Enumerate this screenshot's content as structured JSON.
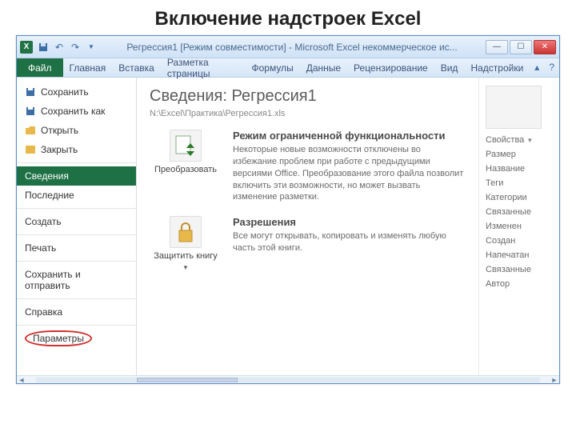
{
  "slide_title": "Включение надстроек Excel",
  "titlebar": {
    "app_letter": "X",
    "document": "Регрессия1 [Режим совместимости] - Microsoft Excel некоммерческое ис..."
  },
  "ribbon": {
    "file": "Файл",
    "tabs": [
      "Главная",
      "Вставка",
      "Разметка страницы",
      "Формулы",
      "Данные",
      "Рецензирование",
      "Вид",
      "Надстройки"
    ]
  },
  "backstage_left": {
    "save": "Сохранить",
    "save_as": "Сохранить как",
    "open": "Открыть",
    "close": "Закрыть",
    "info": "Сведения",
    "recent": "Последние",
    "new": "Создать",
    "print": "Печать",
    "share": "Сохранить и отправить",
    "help": "Справка",
    "options": "Параметры"
  },
  "center": {
    "title": "Сведения: Регрессия1",
    "path": "N:\\Excel\\Практика\\Регрессия1.xls",
    "compat": {
      "button": "Преобразовать",
      "heading": "Режим ограниченной функциональности",
      "body": "Некоторые новые возможности отключены во избежание проблем при работе с предыдущими версиями Office. Преобразование этого файла позволит включить эти возможности, но может вызвать изменение разметки."
    },
    "perm": {
      "button": "Защитить книгу",
      "heading": "Разрешения",
      "body": "Все могут открывать, копировать и изменять любую часть этой книги."
    }
  },
  "right": {
    "props_label": "Свойства",
    "rows": [
      "Размер",
      "Название",
      "Теги",
      "Категории",
      "Связанные",
      "Изменен",
      "Создан",
      "Напечатан",
      "Связанные",
      "Автор"
    ]
  }
}
